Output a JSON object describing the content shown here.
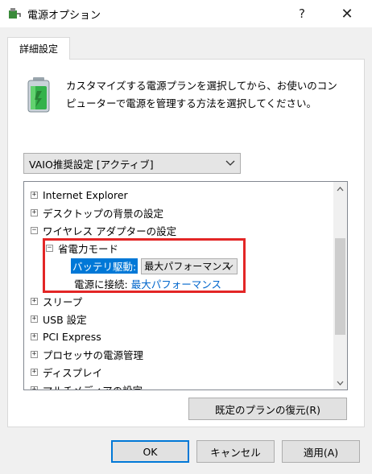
{
  "window": {
    "title": "電源オプション",
    "help": "?",
    "close": "✕"
  },
  "tab": {
    "label": "詳細設定"
  },
  "description": "カスタマイズする電源プランを選択してから、お使いのコンピューターで電源を管理する方法を選択してください。",
  "plan_select": {
    "value": "VAIO推奨設定 [アクティブ]"
  },
  "tree": {
    "items": [
      {
        "label": "Internet Explorer",
        "expander": "+"
      },
      {
        "label": "デスクトップの背景の設定",
        "expander": "+"
      },
      {
        "label": "ワイヤレス アダプターの設定",
        "expander": "−"
      },
      {
        "label": "省電力モード",
        "expander": "−"
      },
      {
        "label": "スリープ",
        "expander": "+"
      },
      {
        "label": "USB 設定",
        "expander": "+"
      },
      {
        "label": "PCI Express",
        "expander": "+"
      },
      {
        "label": "プロセッサの電源管理",
        "expander": "+"
      },
      {
        "label": "ディスプレイ",
        "expander": "+"
      },
      {
        "label": "マルチメディアの設定",
        "expander": "+"
      }
    ],
    "battery": {
      "label": "バッテリ駆動:",
      "value": "最大パフォーマンス"
    },
    "plugged": {
      "label": "電源に接続:",
      "value": "最大パフォーマンス"
    }
  },
  "buttons": {
    "restore": "既定のプランの復元(R)",
    "ok": "OK",
    "cancel": "キャンセル",
    "apply": "適用(A)"
  },
  "colors": {
    "accent": "#0078d7",
    "highlight_border": "#e32626",
    "link": "#0066cc"
  }
}
